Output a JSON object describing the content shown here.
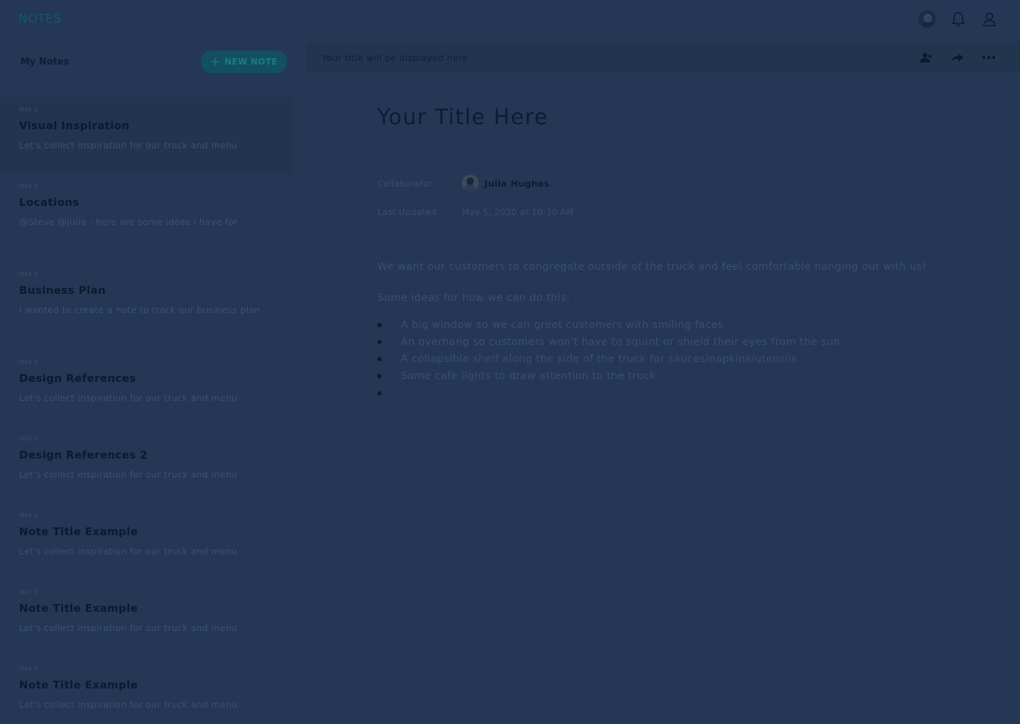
{
  "app": {
    "title": "NOTES"
  },
  "header": {
    "icons": [
      "avatar",
      "bell-icon",
      "user-icon"
    ]
  },
  "sidebar": {
    "title": "My Notes",
    "new_note_label": "NEW NOTE",
    "notes": [
      {
        "date": "MAY 5",
        "title": "Visual Inspiration",
        "preview": "Let's collect inspiration for our truck and menu",
        "active": true
      },
      {
        "date": "MAY 5",
        "title": "Locations",
        "preview": "@Steve @Julia - here are some ideas I have for"
      },
      {
        "date": "MAY 5",
        "title": "Business Plan",
        "preview": "I wanted to create a note to track our business plan"
      },
      {
        "date": "MAY 5",
        "title": "Design References",
        "preview": "Let's collect inspiration for our truck and menu"
      },
      {
        "date": "MAY 5",
        "title": "Design References 2",
        "preview": "Let's collect inspiration for our truck and menu"
      },
      {
        "date": "MAY 5",
        "title": "Note Title Example",
        "preview": "Let's collect inspiration for our truck and menu"
      },
      {
        "date": "MAY 5",
        "title": "Note Title Example",
        "preview": "Let's collect inspiration for our truck and menu"
      },
      {
        "date": "MAY 5",
        "title": "Note Title Example",
        "preview": "Let's collect inspiration for our truck and menu"
      }
    ]
  },
  "editor": {
    "toolbar_title": "Your title will be displayed here",
    "toolbar_icons": [
      "add-person-icon",
      "share-icon",
      "more-icon"
    ],
    "title": "Your Title Here",
    "collaborator_label": "Collaborator",
    "collaborator_name": "Julia Hughes",
    "last_updated_label": "Last Updated",
    "last_updated_value": "May 5, 2020 at 10:30 AM",
    "paragraphs": [
      "We want our customers to congregate outside of the truck and feel comfortable hanging out with us!",
      "Some ideas for how we can do this:"
    ],
    "bullets": [
      "A big window so we can greet customers with smiling faces",
      "An overhang so customers won't have to squint or shield their eyes from the sun",
      "A collapsible shelf along the side of the truck for sauces/napkins/utensils",
      "Some cafe lights to draw attention to the truck",
      ""
    ]
  },
  "colors": {
    "overlay_background": "#243754",
    "brand": "#0e5a72",
    "button": "#13505f"
  }
}
